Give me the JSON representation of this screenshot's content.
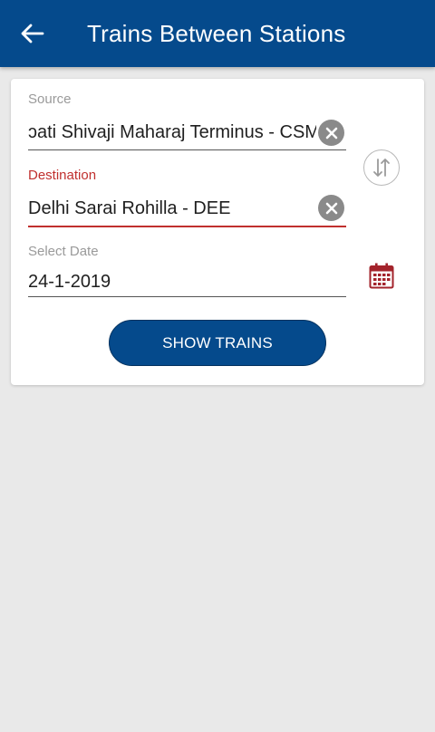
{
  "header": {
    "title": "Trains Between Stations",
    "back_icon": "arrow-left-icon",
    "background_color": "#054a8c"
  },
  "form": {
    "source": {
      "label": "Source",
      "value": "ɔati Shivaji Maharaj Terminus - CSMT",
      "clear_icon": "clear-circle-icon"
    },
    "destination": {
      "label": "Destination",
      "value": "Delhi Sarai Rohilla - DEE",
      "clear_icon": "clear-circle-icon",
      "label_color": "#c0302e"
    },
    "date": {
      "label": "Select Date",
      "value": "24-1-2019",
      "icon": "calendar-icon"
    },
    "swap_icon": "swap-vertical-icon",
    "submit_label": "SHOW TRAINS"
  }
}
